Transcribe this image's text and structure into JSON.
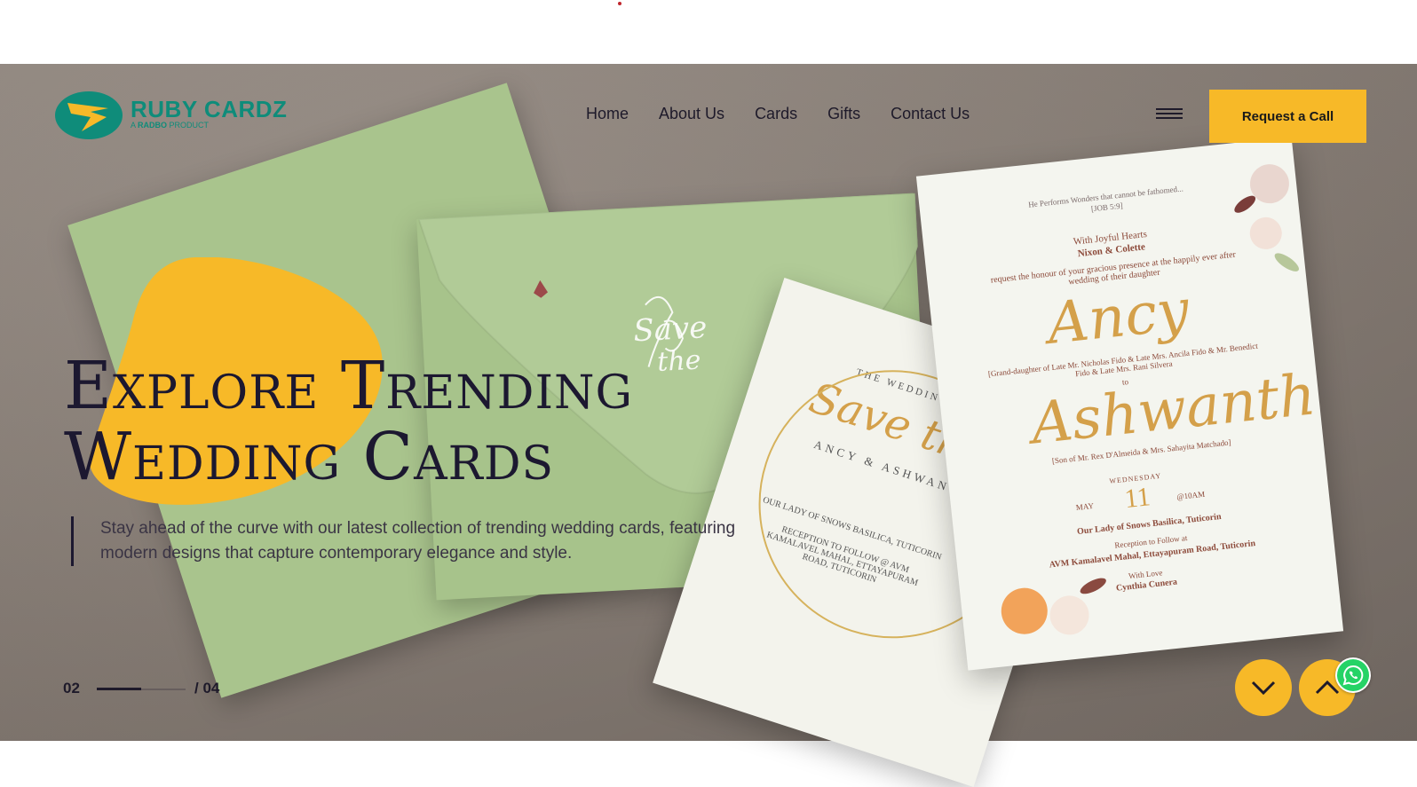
{
  "brand": {
    "name": "RUBY CARDZ",
    "tagline_prefix": "A ",
    "tagline_bold": "RADBO",
    "tagline_suffix": " PRODUCT"
  },
  "nav": {
    "items": [
      "Home",
      "About Us",
      "Cards",
      "Gifts",
      "Contact Us"
    ]
  },
  "cta": {
    "label": "Request a Call"
  },
  "hero": {
    "title_line1": "Explore Trending",
    "title_line2": "Wedding Cards",
    "subtitle": "Stay ahead of the curve with our latest collection of trending wedding cards, featuring modern designs that capture contemporary elegance and style."
  },
  "pager": {
    "current": "02",
    "total": "/ 04",
    "progress": 0.5
  },
  "card": {
    "verse": "He Performs Wonders that cannot be fathomed...",
    "verse_ref": "[JOB 5:9]",
    "joyful": "With Joyful Hearts",
    "parents": "Nixon & Colette",
    "request": "request the honour of your gracious presence at the happily ever after wedding of their daughter",
    "bride": "Ancy",
    "bride_family": "[Grand-daughter of Late Mr. Nicholas Fido & Late Mrs. Ancila Fido & Mr. Benedict Fido & Late Mrs. Rani Silvera",
    "to": "to",
    "groom": "Ashwanth",
    "groom_family": "[Son of Mr. Rex D'Almeida & Mrs. Sahayita Matchado]",
    "weekday": "WEDNESDAY",
    "month": "MAY",
    "day": "11",
    "time": "@10AM",
    "venue": "Our Lady of Snows Basilica, Tuticorin",
    "reception_label": "Reception to Follow at",
    "reception": "AVM Kamalavel Mahal, Ettayapuram Road, Tuticorin",
    "love_label": "With Love",
    "love": "Cynthia Cunera"
  },
  "card2": {
    "header": "THE WEDDING",
    "save": "Save the",
    "names": "ANCY & ASHWANTH",
    "venue": "OUR LADY OF SNOWS BASILICA, TUTICORIN",
    "reception": "RECEPTION TO FOLLOW @ AVM KAMALAVEL MAHAL, ETTAYAPURAM ROAD, TUTICORIN"
  },
  "colors": {
    "accent": "#f7b928",
    "brand": "#0f8c7a",
    "text": "#1c1830",
    "envelope": "#a9c48d"
  },
  "icons": {
    "down": "chevron-down-icon",
    "up": "chevron-up-icon",
    "whatsapp": "whatsapp-icon",
    "menu": "hamburger-icon"
  }
}
